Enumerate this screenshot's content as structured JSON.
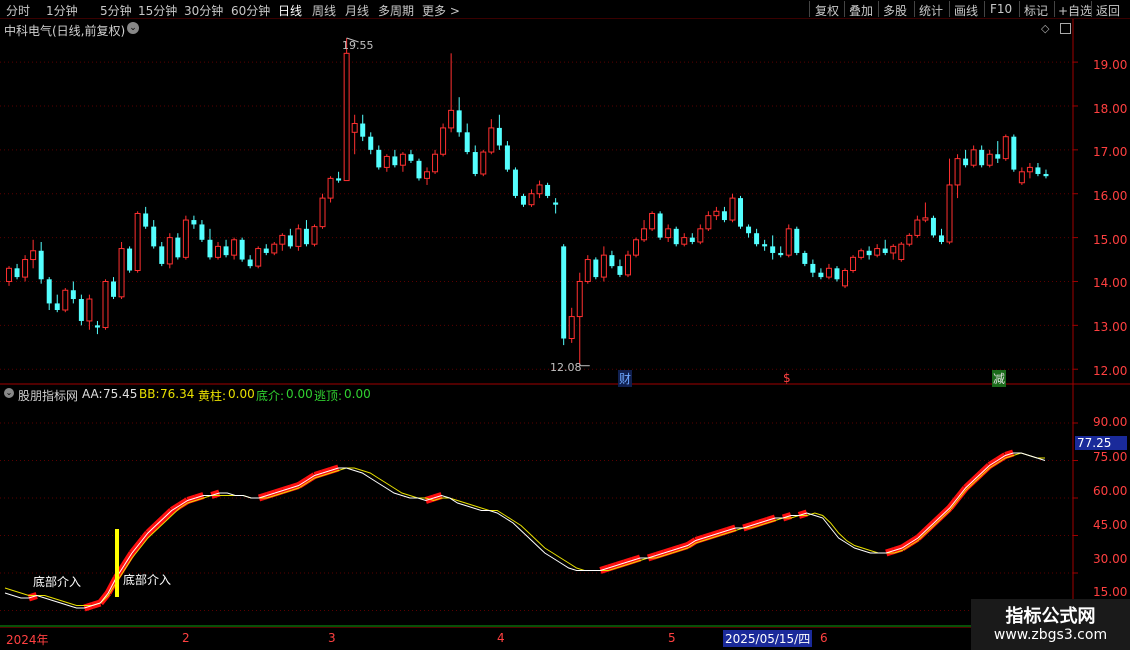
{
  "toolbar": {
    "left_items": [
      "分时",
      "1分钟",
      "5分钟",
      "15分钟",
      "30分钟",
      "60分钟",
      "日线",
      "周线",
      "月线",
      "多周期",
      "更多 >"
    ],
    "right_items": [
      "复权",
      "叠加",
      "多股",
      "统计",
      "画线",
      "F10",
      "标记",
      "+自选",
      "返回"
    ],
    "active": "日线"
  },
  "main_chart": {
    "title": "中科电气(日线,前复权)",
    "high_label": "19.55",
    "low_label": "12.08",
    "yaxis": [
      "19.00",
      "18.00",
      "17.00",
      "16.00",
      "15.00",
      "14.00",
      "13.00",
      "12.00"
    ],
    "event_markers": [
      "财",
      "$",
      "减"
    ]
  },
  "indicator": {
    "name": "股朋指标网",
    "aa_label": "AA:",
    "aa_value": "75.45",
    "bb_label": "BB:",
    "bb_value": "76.34",
    "yellow_label": "黄柱:",
    "yellow_value": "0.00",
    "bottom_label": "底介:",
    "bottom_value": "0.00",
    "top_label": "逃顶:",
    "top_value": "0.00",
    "current_value": "77.25",
    "yaxis": [
      "90.00",
      "75.00",
      "60.00",
      "45.00",
      "30.00",
      "15.00"
    ],
    "annotations": [
      "底部介入",
      "底部介入"
    ]
  },
  "date_axis": {
    "labels": [
      "2024年",
      "2",
      "3",
      "4",
      "5",
      "6"
    ],
    "highlight": "2025/05/15/四"
  },
  "watermark": {
    "title": "指标公式网",
    "url": "www.zbgs3.com"
  },
  "chart_data": {
    "type": "candlestick",
    "title": "中科电气(日线,前复权)",
    "ylim": [
      11.8,
      19.8
    ],
    "candles": [
      {
        "o": 14.0,
        "h": 14.35,
        "l": 13.9,
        "c": 14.3
      },
      {
        "o": 14.3,
        "h": 14.4,
        "l": 14.05,
        "c": 14.1
      },
      {
        "o": 14.1,
        "h": 14.6,
        "l": 14.0,
        "c": 14.5
      },
      {
        "o": 14.5,
        "h": 14.95,
        "l": 14.3,
        "c": 14.7
      },
      {
        "o": 14.7,
        "h": 14.9,
        "l": 13.95,
        "c": 14.05
      },
      {
        "o": 14.05,
        "h": 14.1,
        "l": 13.35,
        "c": 13.5
      },
      {
        "o": 13.5,
        "h": 13.7,
        "l": 13.3,
        "c": 13.35
      },
      {
        "o": 13.35,
        "h": 13.85,
        "l": 13.3,
        "c": 13.8
      },
      {
        "o": 13.8,
        "h": 14.0,
        "l": 13.5,
        "c": 13.6
      },
      {
        "o": 13.6,
        "h": 13.7,
        "l": 13.0,
        "c": 13.1
      },
      {
        "o": 13.1,
        "h": 13.7,
        "l": 12.9,
        "c": 13.6
      },
      {
        "o": 13.0,
        "h": 13.1,
        "l": 12.8,
        "c": 12.95
      },
      {
        "o": 12.95,
        "h": 14.05,
        "l": 12.9,
        "c": 14.0
      },
      {
        "o": 14.0,
        "h": 14.1,
        "l": 13.6,
        "c": 13.65
      },
      {
        "o": 13.65,
        "h": 14.9,
        "l": 13.6,
        "c": 14.75
      },
      {
        "o": 14.75,
        "h": 14.8,
        "l": 14.2,
        "c": 14.25
      },
      {
        "o": 14.25,
        "h": 15.6,
        "l": 14.2,
        "c": 15.55
      },
      {
        "o": 15.55,
        "h": 15.7,
        "l": 15.2,
        "c": 15.25
      },
      {
        "o": 15.25,
        "h": 15.4,
        "l": 14.75,
        "c": 14.8
      },
      {
        "o": 14.8,
        "h": 14.9,
        "l": 14.35,
        "c": 14.4
      },
      {
        "o": 14.4,
        "h": 15.1,
        "l": 14.3,
        "c": 15.0
      },
      {
        "o": 15.0,
        "h": 15.1,
        "l": 14.5,
        "c": 14.55
      },
      {
        "o": 14.55,
        "h": 15.5,
        "l": 14.5,
        "c": 15.4
      },
      {
        "o": 15.4,
        "h": 15.5,
        "l": 15.2,
        "c": 15.3
      },
      {
        "o": 15.3,
        "h": 15.4,
        "l": 14.9,
        "c": 14.95
      },
      {
        "o": 14.95,
        "h": 15.2,
        "l": 14.5,
        "c": 14.55
      },
      {
        "o": 14.55,
        "h": 14.9,
        "l": 14.5,
        "c": 14.8
      },
      {
        "o": 14.8,
        "h": 14.95,
        "l": 14.55,
        "c": 14.6
      },
      {
        "o": 14.6,
        "h": 15.0,
        "l": 14.5,
        "c": 14.95
      },
      {
        "o": 14.95,
        "h": 15.0,
        "l": 14.45,
        "c": 14.5
      },
      {
        "o": 14.5,
        "h": 14.6,
        "l": 14.3,
        "c": 14.35
      },
      {
        "o": 14.35,
        "h": 14.8,
        "l": 14.3,
        "c": 14.75
      },
      {
        "o": 14.75,
        "h": 14.85,
        "l": 14.6,
        "c": 14.65
      },
      {
        "o": 14.65,
        "h": 14.9,
        "l": 14.6,
        "c": 14.85
      },
      {
        "o": 14.85,
        "h": 15.1,
        "l": 14.7,
        "c": 15.05
      },
      {
        "o": 15.05,
        "h": 15.2,
        "l": 14.75,
        "c": 14.8
      },
      {
        "o": 14.8,
        "h": 15.3,
        "l": 14.7,
        "c": 15.2
      },
      {
        "o": 15.2,
        "h": 15.4,
        "l": 14.8,
        "c": 14.85
      },
      {
        "o": 14.85,
        "h": 15.3,
        "l": 14.8,
        "c": 15.25
      },
      {
        "o": 15.25,
        "h": 16.0,
        "l": 15.2,
        "c": 15.9
      },
      {
        "o": 15.9,
        "h": 16.4,
        "l": 15.8,
        "c": 16.35
      },
      {
        "o": 16.35,
        "h": 16.5,
        "l": 16.25,
        "c": 16.3
      },
      {
        "o": 16.3,
        "h": 19.55,
        "l": 16.3,
        "c": 19.2
      },
      {
        "o": 17.4,
        "h": 17.8,
        "l": 16.9,
        "c": 17.6
      },
      {
        "o": 17.6,
        "h": 17.8,
        "l": 17.2,
        "c": 17.3
      },
      {
        "o": 17.3,
        "h": 17.4,
        "l": 16.9,
        "c": 17.0
      },
      {
        "o": 17.0,
        "h": 17.1,
        "l": 16.55,
        "c": 16.6
      },
      {
        "o": 16.6,
        "h": 16.9,
        "l": 16.5,
        "c": 16.85
      },
      {
        "o": 16.85,
        "h": 17.0,
        "l": 16.6,
        "c": 16.65
      },
      {
        "o": 16.65,
        "h": 16.95,
        "l": 16.5,
        "c": 16.9
      },
      {
        "o": 16.9,
        "h": 17.0,
        "l": 16.7,
        "c": 16.75
      },
      {
        "o": 16.75,
        "h": 16.8,
        "l": 16.3,
        "c": 16.35
      },
      {
        "o": 16.35,
        "h": 16.6,
        "l": 16.2,
        "c": 16.5
      },
      {
        "o": 16.5,
        "h": 17.0,
        "l": 16.45,
        "c": 16.9
      },
      {
        "o": 16.9,
        "h": 17.6,
        "l": 16.85,
        "c": 17.5
      },
      {
        "o": 17.5,
        "h": 19.2,
        "l": 17.4,
        "c": 17.9
      },
      {
        "o": 17.9,
        "h": 18.2,
        "l": 17.3,
        "c": 17.4
      },
      {
        "o": 17.4,
        "h": 17.6,
        "l": 16.9,
        "c": 16.95
      },
      {
        "o": 16.95,
        "h": 17.1,
        "l": 16.4,
        "c": 16.45
      },
      {
        "o": 16.45,
        "h": 17.0,
        "l": 16.4,
        "c": 16.95
      },
      {
        "o": 16.95,
        "h": 17.7,
        "l": 16.9,
        "c": 17.5
      },
      {
        "o": 17.5,
        "h": 17.8,
        "l": 17.0,
        "c": 17.1
      },
      {
        "o": 17.1,
        "h": 17.2,
        "l": 16.5,
        "c": 16.55
      },
      {
        "o": 16.55,
        "h": 16.6,
        "l": 15.9,
        "c": 15.95
      },
      {
        "o": 15.95,
        "h": 16.0,
        "l": 15.7,
        "c": 15.75
      },
      {
        "o": 15.75,
        "h": 16.1,
        "l": 15.7,
        "c": 16.0
      },
      {
        "o": 16.0,
        "h": 16.3,
        "l": 15.9,
        "c": 16.2
      },
      {
        "o": 16.2,
        "h": 16.25,
        "l": 15.9,
        "c": 15.95
      },
      {
        "o": 15.8,
        "h": 15.9,
        "l": 15.55,
        "c": 15.75
      },
      {
        "o": 14.8,
        "h": 14.85,
        "l": 12.55,
        "c": 12.7
      },
      {
        "o": 12.7,
        "h": 13.4,
        "l": 12.6,
        "c": 13.2
      },
      {
        "o": 13.2,
        "h": 14.2,
        "l": 12.08,
        "c": 14.0
      },
      {
        "o": 14.0,
        "h": 14.6,
        "l": 13.95,
        "c": 14.5
      },
      {
        "o": 14.5,
        "h": 14.55,
        "l": 14.05,
        "c": 14.1
      },
      {
        "o": 14.1,
        "h": 14.8,
        "l": 14.0,
        "c": 14.6
      },
      {
        "o": 14.6,
        "h": 14.7,
        "l": 14.3,
        "c": 14.35
      },
      {
        "o": 14.35,
        "h": 14.5,
        "l": 14.1,
        "c": 14.15
      },
      {
        "o": 14.15,
        "h": 14.7,
        "l": 14.1,
        "c": 14.6
      },
      {
        "o": 14.6,
        "h": 15.0,
        "l": 14.55,
        "c": 14.95
      },
      {
        "o": 14.95,
        "h": 15.4,
        "l": 14.9,
        "c": 15.2
      },
      {
        "o": 15.2,
        "h": 15.6,
        "l": 15.15,
        "c": 15.55
      },
      {
        "o": 15.55,
        "h": 15.6,
        "l": 14.95,
        "c": 15.0
      },
      {
        "o": 15.0,
        "h": 15.3,
        "l": 14.9,
        "c": 15.2
      },
      {
        "o": 15.2,
        "h": 15.25,
        "l": 14.8,
        "c": 14.85
      },
      {
        "o": 14.85,
        "h": 15.1,
        "l": 14.8,
        "c": 15.0
      },
      {
        "o": 15.0,
        "h": 15.1,
        "l": 14.85,
        "c": 14.9
      },
      {
        "o": 14.9,
        "h": 15.3,
        "l": 14.85,
        "c": 15.2
      },
      {
        "o": 15.2,
        "h": 15.6,
        "l": 15.15,
        "c": 15.5
      },
      {
        "o": 15.5,
        "h": 15.7,
        "l": 15.4,
        "c": 15.6
      },
      {
        "o": 15.6,
        "h": 15.7,
        "l": 15.35,
        "c": 15.4
      },
      {
        "o": 15.4,
        "h": 16.0,
        "l": 15.35,
        "c": 15.9
      },
      {
        "o": 15.9,
        "h": 15.95,
        "l": 15.2,
        "c": 15.25
      },
      {
        "o": 15.25,
        "h": 15.3,
        "l": 15.0,
        "c": 15.1
      },
      {
        "o": 15.1,
        "h": 15.2,
        "l": 14.8,
        "c": 14.85
      },
      {
        "o": 14.85,
        "h": 14.95,
        "l": 14.7,
        "c": 14.8
      },
      {
        "o": 14.8,
        "h": 15.05,
        "l": 14.5,
        "c": 14.65
      },
      {
        "o": 14.65,
        "h": 14.8,
        "l": 14.55,
        "c": 14.6
      },
      {
        "o": 14.6,
        "h": 15.3,
        "l": 14.55,
        "c": 15.2
      },
      {
        "o": 15.2,
        "h": 15.25,
        "l": 14.6,
        "c": 14.65
      },
      {
        "o": 14.65,
        "h": 14.7,
        "l": 14.35,
        "c": 14.4
      },
      {
        "o": 14.4,
        "h": 14.5,
        "l": 14.1,
        "c": 14.2
      },
      {
        "o": 14.2,
        "h": 14.3,
        "l": 14.05,
        "c": 14.1
      },
      {
        "o": 14.1,
        "h": 14.4,
        "l": 14.05,
        "c": 14.3
      },
      {
        "o": 14.3,
        "h": 14.35,
        "l": 14.0,
        "c": 14.05
      },
      {
        "o": 13.9,
        "h": 14.3,
        "l": 13.85,
        "c": 14.25
      },
      {
        "o": 14.25,
        "h": 14.6,
        "l": 14.2,
        "c": 14.55
      },
      {
        "o": 14.55,
        "h": 14.75,
        "l": 14.5,
        "c": 14.7
      },
      {
        "o": 14.7,
        "h": 14.8,
        "l": 14.5,
        "c": 14.6
      },
      {
        "o": 14.6,
        "h": 14.85,
        "l": 14.55,
        "c": 14.75
      },
      {
        "o": 14.75,
        "h": 14.95,
        "l": 14.6,
        "c": 14.65
      },
      {
        "o": 14.65,
        "h": 14.85,
        "l": 14.5,
        "c": 14.8
      },
      {
        "o": 14.5,
        "h": 14.9,
        "l": 14.45,
        "c": 14.85
      },
      {
        "o": 14.85,
        "h": 15.1,
        "l": 14.8,
        "c": 15.05
      },
      {
        "o": 15.05,
        "h": 15.5,
        "l": 15.0,
        "c": 15.4
      },
      {
        "o": 15.4,
        "h": 15.8,
        "l": 15.35,
        "c": 15.45
      },
      {
        "o": 15.45,
        "h": 15.5,
        "l": 15.0,
        "c": 15.05
      },
      {
        "o": 15.05,
        "h": 15.2,
        "l": 14.85,
        "c": 14.9
      },
      {
        "o": 14.9,
        "h": 16.8,
        "l": 14.85,
        "c": 16.2
      },
      {
        "o": 16.2,
        "h": 16.9,
        "l": 15.9,
        "c": 16.8
      },
      {
        "o": 16.8,
        "h": 17.0,
        "l": 16.6,
        "c": 16.65
      },
      {
        "o": 16.65,
        "h": 17.1,
        "l": 16.6,
        "c": 17.0
      },
      {
        "o": 17.0,
        "h": 17.1,
        "l": 16.6,
        "c": 16.65
      },
      {
        "o": 16.65,
        "h": 17.0,
        "l": 16.6,
        "c": 16.9
      },
      {
        "o": 16.9,
        "h": 17.2,
        "l": 16.7,
        "c": 16.8
      },
      {
        "o": 16.8,
        "h": 17.35,
        "l": 16.75,
        "c": 17.3
      },
      {
        "o": 17.3,
        "h": 17.35,
        "l": 16.5,
        "c": 16.55
      },
      {
        "o": 16.25,
        "h": 16.6,
        "l": 16.2,
        "c": 16.5
      },
      {
        "o": 16.5,
        "h": 16.7,
        "l": 16.35,
        "c": 16.6
      },
      {
        "o": 16.6,
        "h": 16.7,
        "l": 16.4,
        "c": 16.45
      },
      {
        "o": 16.45,
        "h": 16.55,
        "l": 16.35,
        "c": 16.4
      }
    ],
    "indicator_aa": [
      22,
      21,
      20,
      20,
      21,
      20,
      19,
      18,
      17,
      16,
      16,
      17,
      18,
      22,
      28,
      33,
      38,
      42,
      46,
      49,
      52,
      55,
      57,
      59,
      60,
      61,
      61,
      62,
      62,
      61,
      61,
      60,
      60,
      61,
      62,
      63,
      64,
      65,
      67,
      69,
      70,
      71,
      72,
      72,
      71,
      70,
      68,
      66,
      64,
      62,
      61,
      60,
      60,
      59,
      60,
      61,
      60,
      58,
      57,
      56,
      55,
      55,
      54,
      52,
      50,
      47,
      44,
      41,
      38,
      36,
      34,
      32,
      31,
      31,
      31,
      31,
      32,
      33,
      34,
      35,
      36,
      36,
      37,
      38,
      39,
      40,
      41,
      43,
      44,
      45,
      46,
      47,
      48,
      48,
      49,
      50,
      51,
      52,
      52,
      53,
      53,
      54,
      53,
      52,
      48,
      44,
      42,
      40,
      39,
      38,
      38,
      38,
      39,
      40,
      42,
      44,
      47,
      50,
      53,
      56,
      60,
      64,
      67,
      70,
      73,
      75,
      77,
      78,
      78,
      77,
      76,
      75
    ],
    "indicator_bb": [
      24,
      23,
      22,
      21,
      21,
      21,
      20,
      19,
      18,
      17,
      17,
      17,
      18,
      21,
      26,
      31,
      36,
      40,
      44,
      47,
      50,
      53,
      56,
      58,
      59,
      60,
      61,
      61,
      61,
      61,
      61,
      60,
      60,
      60,
      61,
      62,
      63,
      64,
      66,
      68,
      69,
      70,
      71,
      72,
      72,
      71,
      70,
      68,
      66,
      64,
      62,
      61,
      60,
      60,
      59,
      60,
      60,
      59,
      58,
      57,
      56,
      55,
      55,
      53,
      51,
      49,
      46,
      43,
      40,
      38,
      36,
      34,
      32,
      31,
      31,
      31,
      31,
      32,
      33,
      34,
      35,
      36,
      36,
      37,
      38,
      39,
      40,
      42,
      43,
      44,
      45,
      46,
      47,
      48,
      48,
      49,
      50,
      51,
      52,
      52,
      53,
      53,
      54,
      53,
      50,
      46,
      43,
      41,
      40,
      39,
      38,
      38,
      38,
      39,
      41,
      43,
      46,
      49,
      52,
      55,
      59,
      63,
      66,
      69,
      72,
      74,
      76,
      77,
      78,
      77,
      76,
      76
    ],
    "indicator_ylim": [
      10,
      100
    ]
  }
}
